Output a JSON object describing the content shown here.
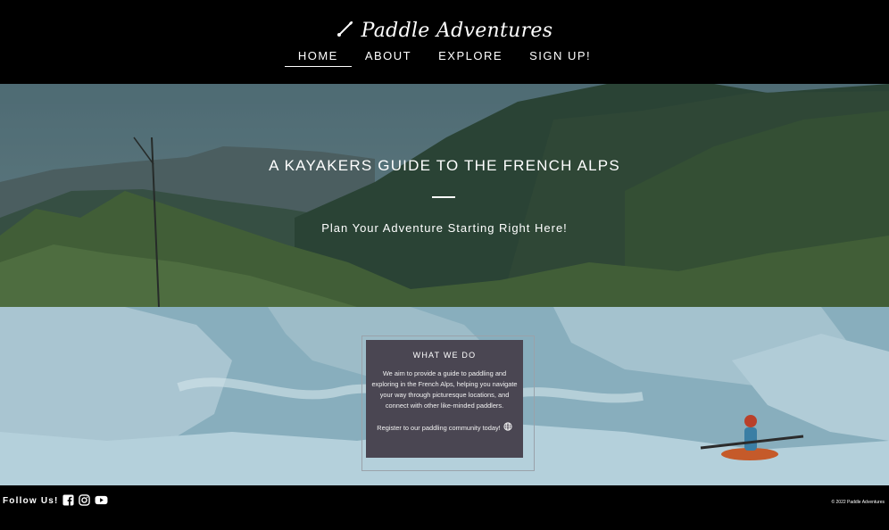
{
  "brand": {
    "name": "Paddle Adventures",
    "logo_icon": "paddle-icon"
  },
  "nav": {
    "items": [
      {
        "label": "HOME",
        "active": true
      },
      {
        "label": "ABOUT",
        "active": false
      },
      {
        "label": "EXPLORE",
        "active": false
      },
      {
        "label": "SIGN UP!",
        "active": false
      }
    ]
  },
  "hero": {
    "title": "A KAYAKERS GUIDE TO THE FRENCH ALPS",
    "subtitle": "Plan Your Adventure Starting Right Here!"
  },
  "card": {
    "title": "WHAT WE DO",
    "body": "We aim to provide a guide to paddling and exploring in the French Alps, helping you navigate your way through picturesque locations, and connect with other like-minded paddlers.",
    "cta": "Register to our paddling community today!",
    "cta_icon": "globe-icon"
  },
  "footer": {
    "follow_label": "Follow Us!",
    "social_icons": [
      "facebook-icon",
      "instagram-icon",
      "youtube-icon"
    ],
    "copyright": "© 2022 Paddle Adventures"
  },
  "colors": {
    "header_bg": "#000000",
    "card_bg": "#4a4652",
    "hero_overlay": "#3a5a66",
    "rapids_overlay": "#8fb4c4"
  }
}
